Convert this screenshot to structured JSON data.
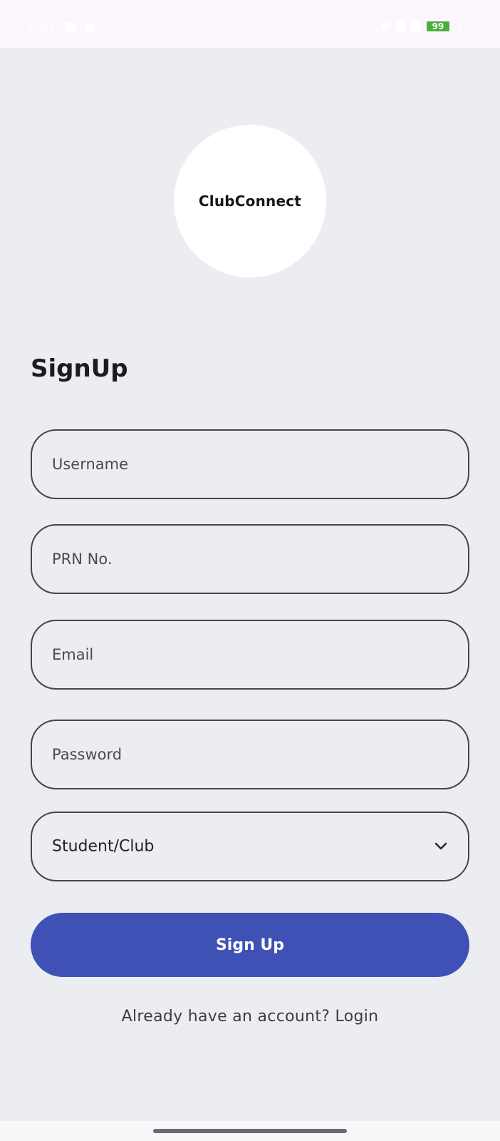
{
  "status_bar": {
    "time": "5:37",
    "battery": "99"
  },
  "logo": {
    "text": "ClubConnect"
  },
  "form": {
    "title": "SignUp",
    "username_placeholder": "Username",
    "prn_placeholder": "PRN No.",
    "email_placeholder": "Email",
    "password_placeholder": "Password",
    "role_select_value": "Student/Club",
    "submit_label": "Sign Up",
    "login_prompt": "Already have an account? Login"
  },
  "colors": {
    "background": "#ebedf1",
    "primary": "#3f51b5",
    "field_border": "#45454a"
  },
  "icons": {
    "dropdown": "chevron-down-icon"
  }
}
